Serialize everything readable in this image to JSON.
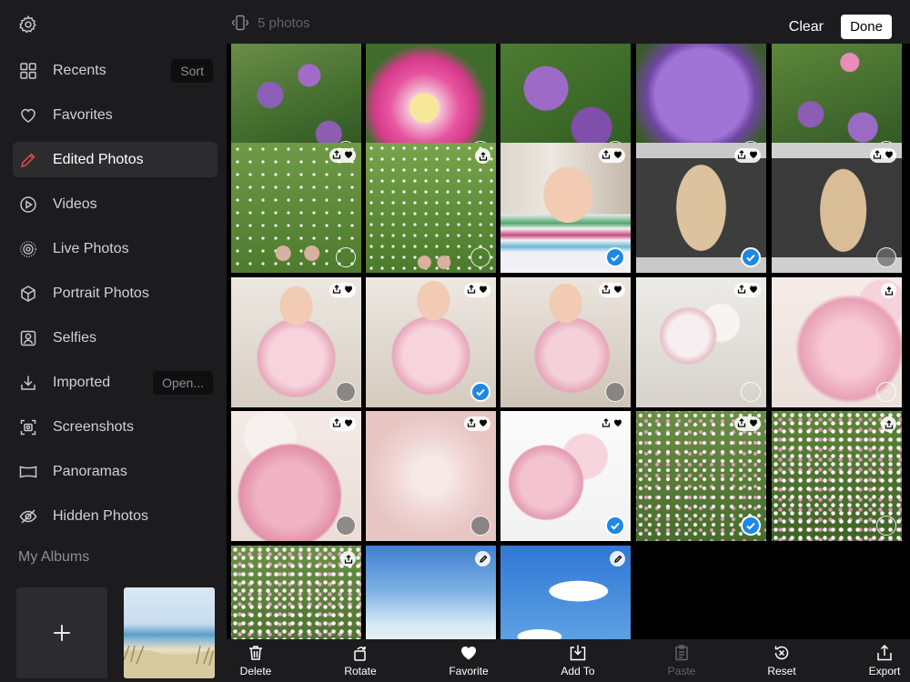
{
  "header": {
    "photo_count": "5 photos",
    "clear_label": "Clear",
    "done_label": "Done"
  },
  "sidebar": {
    "items": [
      {
        "label": "Recents",
        "icon": "grid-icon",
        "pill": "Sort"
      },
      {
        "label": "Favorites",
        "icon": "heart-icon"
      },
      {
        "label": "Edited Photos",
        "icon": "pencil-icon",
        "active": true
      },
      {
        "label": "Videos",
        "icon": "play-icon"
      },
      {
        "label": "Live Photos",
        "icon": "live-photo-icon"
      },
      {
        "label": "Portrait Photos",
        "icon": "cube-icon"
      },
      {
        "label": "Selfies",
        "icon": "selfie-icon"
      },
      {
        "label": "Imported",
        "icon": "download-icon",
        "pill": "Open..."
      },
      {
        "label": "Screenshots",
        "icon": "screenshot-icon"
      },
      {
        "label": "Panoramas",
        "icon": "panorama-icon"
      },
      {
        "label": "Hidden Photos",
        "icon": "eye-slash-icon"
      }
    ],
    "albums_heading": "My Albums"
  },
  "toolbar": {
    "buttons": [
      {
        "label": "Delete",
        "icon": "trash-icon"
      },
      {
        "label": "Rotate",
        "icon": "rotate-icon"
      },
      {
        "label": "Favorite",
        "icon": "heart-filled-icon"
      },
      {
        "label": "Add To",
        "icon": "add-to-icon"
      },
      {
        "label": "Paste",
        "icon": "clipboard-icon",
        "disabled": true
      },
      {
        "label": "Reset",
        "icon": "reset-icon"
      },
      {
        "label": "Export",
        "icon": "export-icon"
      }
    ]
  },
  "photos": [
    {
      "subject": "allium-garden",
      "badges": "none",
      "selection": "empty"
    },
    {
      "subject": "pink-peony-closeup",
      "badges": "none",
      "selection": "empty"
    },
    {
      "subject": "purple-allium",
      "badges": "none",
      "selection": "empty"
    },
    {
      "subject": "allium-star",
      "badges": "none",
      "selection": "empty"
    },
    {
      "subject": "allium-bush",
      "badges": "none",
      "selection": "empty"
    },
    {
      "subject": "daisy-lawn-feet",
      "badges": "share-heart",
      "selection": "empty"
    },
    {
      "subject": "daisy-lawn-feet-2",
      "badges": "share",
      "selection": "empty"
    },
    {
      "subject": "woman-in-hat-office",
      "badges": "share-heart",
      "selection": "selected"
    },
    {
      "subject": "dog-on-mat",
      "badges": "share-heart",
      "selection": "selected"
    },
    {
      "subject": "dog-on-mat-2",
      "badges": "share-heart",
      "selection": "grey"
    },
    {
      "subject": "woman-with-peonies",
      "badges": "share-heart",
      "selection": "grey"
    },
    {
      "subject": "woman-with-peonies-2",
      "badges": "share-heart",
      "selection": "selected"
    },
    {
      "subject": "woman-with-peonies-3",
      "badges": "share-heart",
      "selection": "grey"
    },
    {
      "subject": "peony-vase",
      "badges": "share-heart",
      "selection": "empty"
    },
    {
      "subject": "pink-peonies",
      "badges": "share",
      "selection": "empty"
    },
    {
      "subject": "pink-peonies-closeup",
      "badges": "share-heart",
      "selection": "grey"
    },
    {
      "subject": "pale-peony",
      "badges": "share-heart",
      "selection": "grey"
    },
    {
      "subject": "peonies-white-bg",
      "badges": "share-heart",
      "selection": "selected"
    },
    {
      "subject": "daisy-meadow",
      "badges": "share-heart",
      "selection": "selected"
    },
    {
      "subject": "daisy-meadow-2",
      "badges": "share",
      "selection": "empty"
    },
    {
      "subject": "daisy-field",
      "badges": "share",
      "selection": "none"
    },
    {
      "subject": "blue-sky-sea",
      "badges": "edit",
      "selection": "none"
    },
    {
      "subject": "blue-sky-clouds",
      "badges": "edit",
      "selection": "none"
    }
  ],
  "colors": {
    "sidebar_bg": "#1c1c1e",
    "active_accent": "#e5484d",
    "selection_blue": "#1e88e5"
  }
}
